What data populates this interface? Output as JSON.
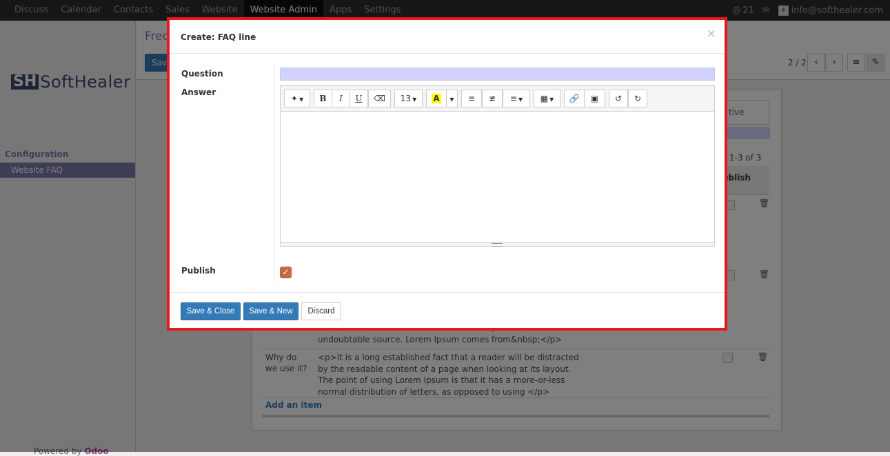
{
  "navbar": {
    "menus": [
      "Discuss",
      "Calendar",
      "Contacts",
      "Sales",
      "Website",
      "Website Admin",
      "Apps",
      "Settings"
    ],
    "active_menu": "Website Admin",
    "notifications": "21",
    "user_email": "info@softhealer.com"
  },
  "sidebar": {
    "logo_mark": "SH",
    "logo_word": "SoftHealer",
    "section": "Configuration",
    "item": "Website FAQ",
    "powered_by": "Powered by",
    "powered_brand": "Odoo"
  },
  "background": {
    "breadcrumb": "Freq",
    "save_label": "Save",
    "pager": "2 / 2",
    "tab_partial": "tive",
    "count": "1-3 of 3",
    "col_publish": "ublish",
    "rows": [
      {
        "question": "",
        "answer": "the cites of the word in classical literature, discovered the undoubtable source. Lorem Ipsum comes from&nbsp;</p>"
      },
      {
        "question": "Why do we use it?",
        "answer": "<p>It is a long established fact that a reader will be distracted by the readable content of a page when looking at its layout. The point of using Lorem Ipsum is that it has a more-or-less normal distribution of letters, as opposed to using </p>"
      }
    ],
    "add_item": "Add an item"
  },
  "modal": {
    "title": "Create: FAQ line",
    "close_glyph": "×",
    "question_label": "Question",
    "question_value": "",
    "answer_label": "Answer",
    "publish_label": "Publish",
    "publish_checked": true,
    "font_size": "13",
    "buttons": {
      "save_close": "Save & Close",
      "save_new": "Save & New",
      "discard": "Discard"
    }
  },
  "icons": {
    "magic": "magic-wand-icon",
    "eraser": "eraser-icon",
    "ul": "unordered-list-icon",
    "ol": "ordered-list-icon",
    "align": "align-left-icon",
    "table": "table-icon",
    "link": "link-icon",
    "image": "image-icon",
    "undo": "undo-icon",
    "redo": "redo-icon"
  },
  "colors": {
    "highlight_border": "#e8171b",
    "primary": "#337ab7",
    "brand": "#7c7bad",
    "required_field": "#d2d2ff",
    "checkbox": "#c46a42"
  }
}
